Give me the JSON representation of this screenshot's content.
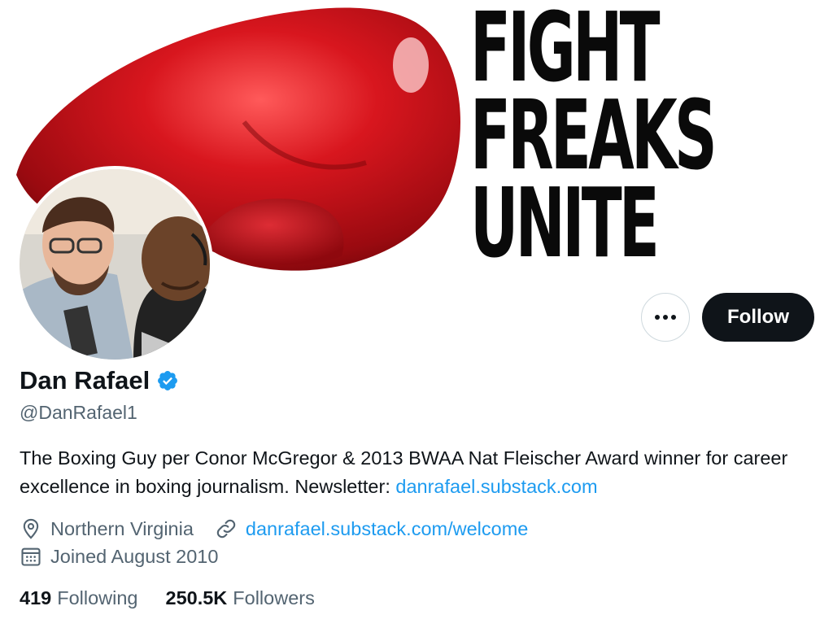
{
  "banner": {
    "slogan": [
      "FIGHT",
      "FREAKS",
      "UNITE"
    ]
  },
  "profile": {
    "name": "Dan Rafael",
    "handle": "@DanRafael1",
    "bio_text": "The Boxing Guy per Conor McGregor & 2013 BWAA Nat Fleischer Award winner for career excellence in boxing journalism. Newsletter: ",
    "bio_link": "danrafael.substack.com",
    "location": "Northern Virginia",
    "website": "danrafael.substack.com/welcome",
    "joined": "Joined August 2010"
  },
  "actions": {
    "more_label": "•••",
    "follow_label": "Follow"
  },
  "stats": {
    "following_count": "419",
    "following_label": "Following",
    "followers_count": "250.5K",
    "followers_label": "Followers"
  },
  "icons": {
    "more": "more-icon",
    "verified": "verified-badge-icon",
    "location": "location-pin-icon",
    "link": "link-icon",
    "calendar": "calendar-icon"
  },
  "colors": {
    "accent_link": "#1d9bf0",
    "text_primary": "#0f1419",
    "text_secondary": "#536471",
    "follow_button": "#0f1419",
    "glove_red": "#c8141c"
  }
}
